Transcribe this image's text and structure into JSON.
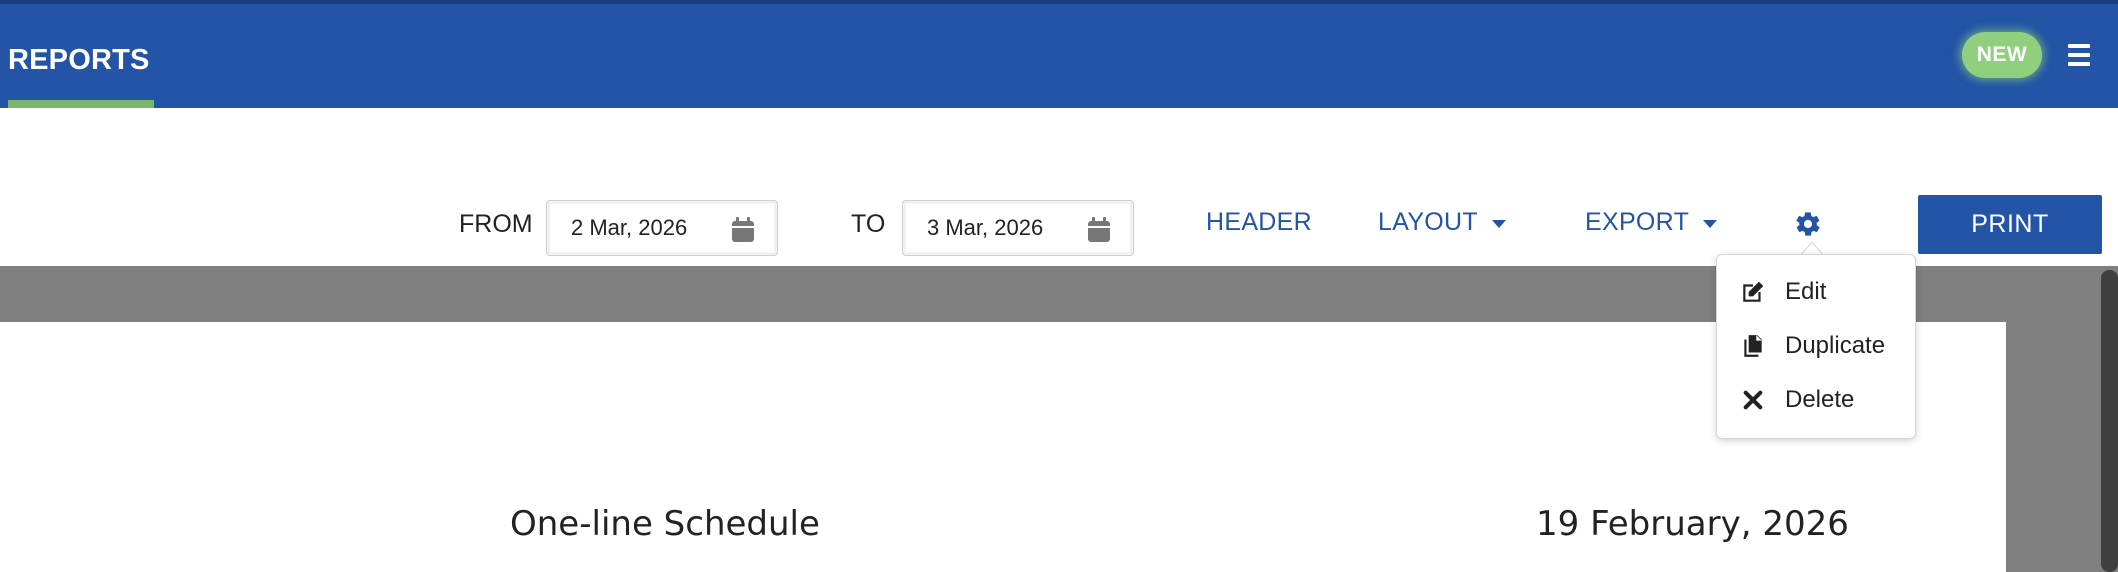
{
  "header": {
    "title": "REPORTS",
    "badge": "NEW",
    "colors": {
      "bar": "#2354a5",
      "accent": "#79b86a",
      "badge": "#8fcf7d"
    }
  },
  "toolbar": {
    "from_label": "FROM",
    "from_value": "2 Mar, 2026",
    "to_label": "TO",
    "to_value": "3 Mar, 2026",
    "header_link": "HEADER",
    "layout_link": "LAYOUT",
    "export_link": "EXPORT",
    "print_label": "PRINT",
    "settings_icon": "gear-icon"
  },
  "settings_menu": {
    "items": [
      {
        "label": "Edit",
        "icon": "edit-icon"
      },
      {
        "label": "Duplicate",
        "icon": "duplicate-icon"
      },
      {
        "label": "Delete",
        "icon": "close-icon"
      }
    ]
  },
  "preview": {
    "title": "One-line Schedule",
    "date": "19 February, 2026"
  }
}
